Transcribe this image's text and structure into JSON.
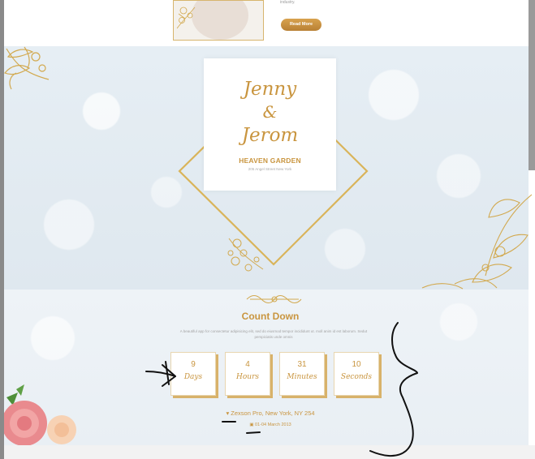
{
  "top": {
    "blurb": "industry.",
    "read_more_label": "Read More"
  },
  "hero": {
    "bride": "Jenny",
    "ampersand": "&",
    "groom": "Jerom",
    "venue": "HEAVEN GARDEN",
    "venue_address": "205 Angel Street New York"
  },
  "countdown": {
    "title": "Count Down",
    "description": "A beautiful app for consectetur adipisicing elit, sed do eiusmod tempor incididunt ut. moll anim id est laborum. Sedut perspiciatis unde omnis",
    "units": [
      {
        "value": "9",
        "label": "Days"
      },
      {
        "value": "4",
        "label": "Hours"
      },
      {
        "value": "31",
        "label": "Minutes"
      },
      {
        "value": "10",
        "label": "Seconds"
      }
    ],
    "location": "Zexson Pro, New York, NY 254",
    "date": "01-04 March 2013"
  },
  "colors": {
    "gold": "#c9953f",
    "background": "#e6eef4"
  },
  "icons": [
    "location-pin-icon",
    "calendar-icon"
  ]
}
